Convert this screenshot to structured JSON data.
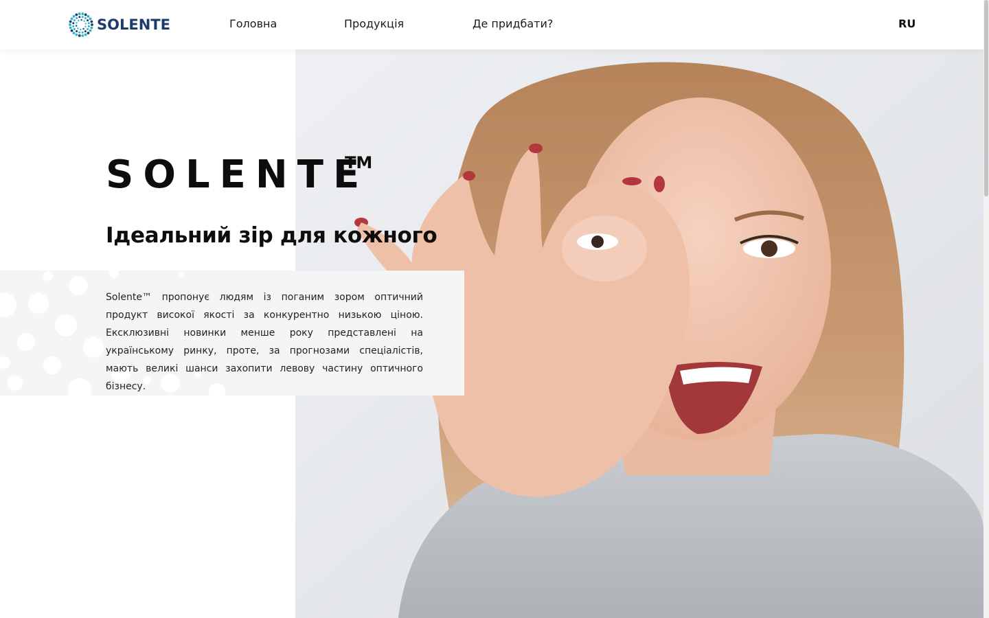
{
  "header": {
    "logo_text": "SOLENTE",
    "nav": [
      {
        "label": "Головна"
      },
      {
        "label": "Продукція"
      },
      {
        "label": "Де придбати?"
      }
    ],
    "language": "RU"
  },
  "hero": {
    "brand": "SOLENTE",
    "trademark": "TM",
    "tagline": "Ідеальний зір для кожного",
    "description": "Solente™ пропонує людям із поганим зором оптичний продукт високої якості за конкурентно низькою ціною. Ексклюзивні новинки менше року представлені на українському ринку, проте, за прогнозами спеціалістів, мають великі шанси захопити левову частину оптичного бізнесу."
  },
  "colors": {
    "logo_navy": "#1d3a6b",
    "logo_teal": "#2bb3c8",
    "text": "#0d0d0d",
    "panel": "#f5f5f5"
  },
  "icons": [
    "logo-ring-icon"
  ]
}
